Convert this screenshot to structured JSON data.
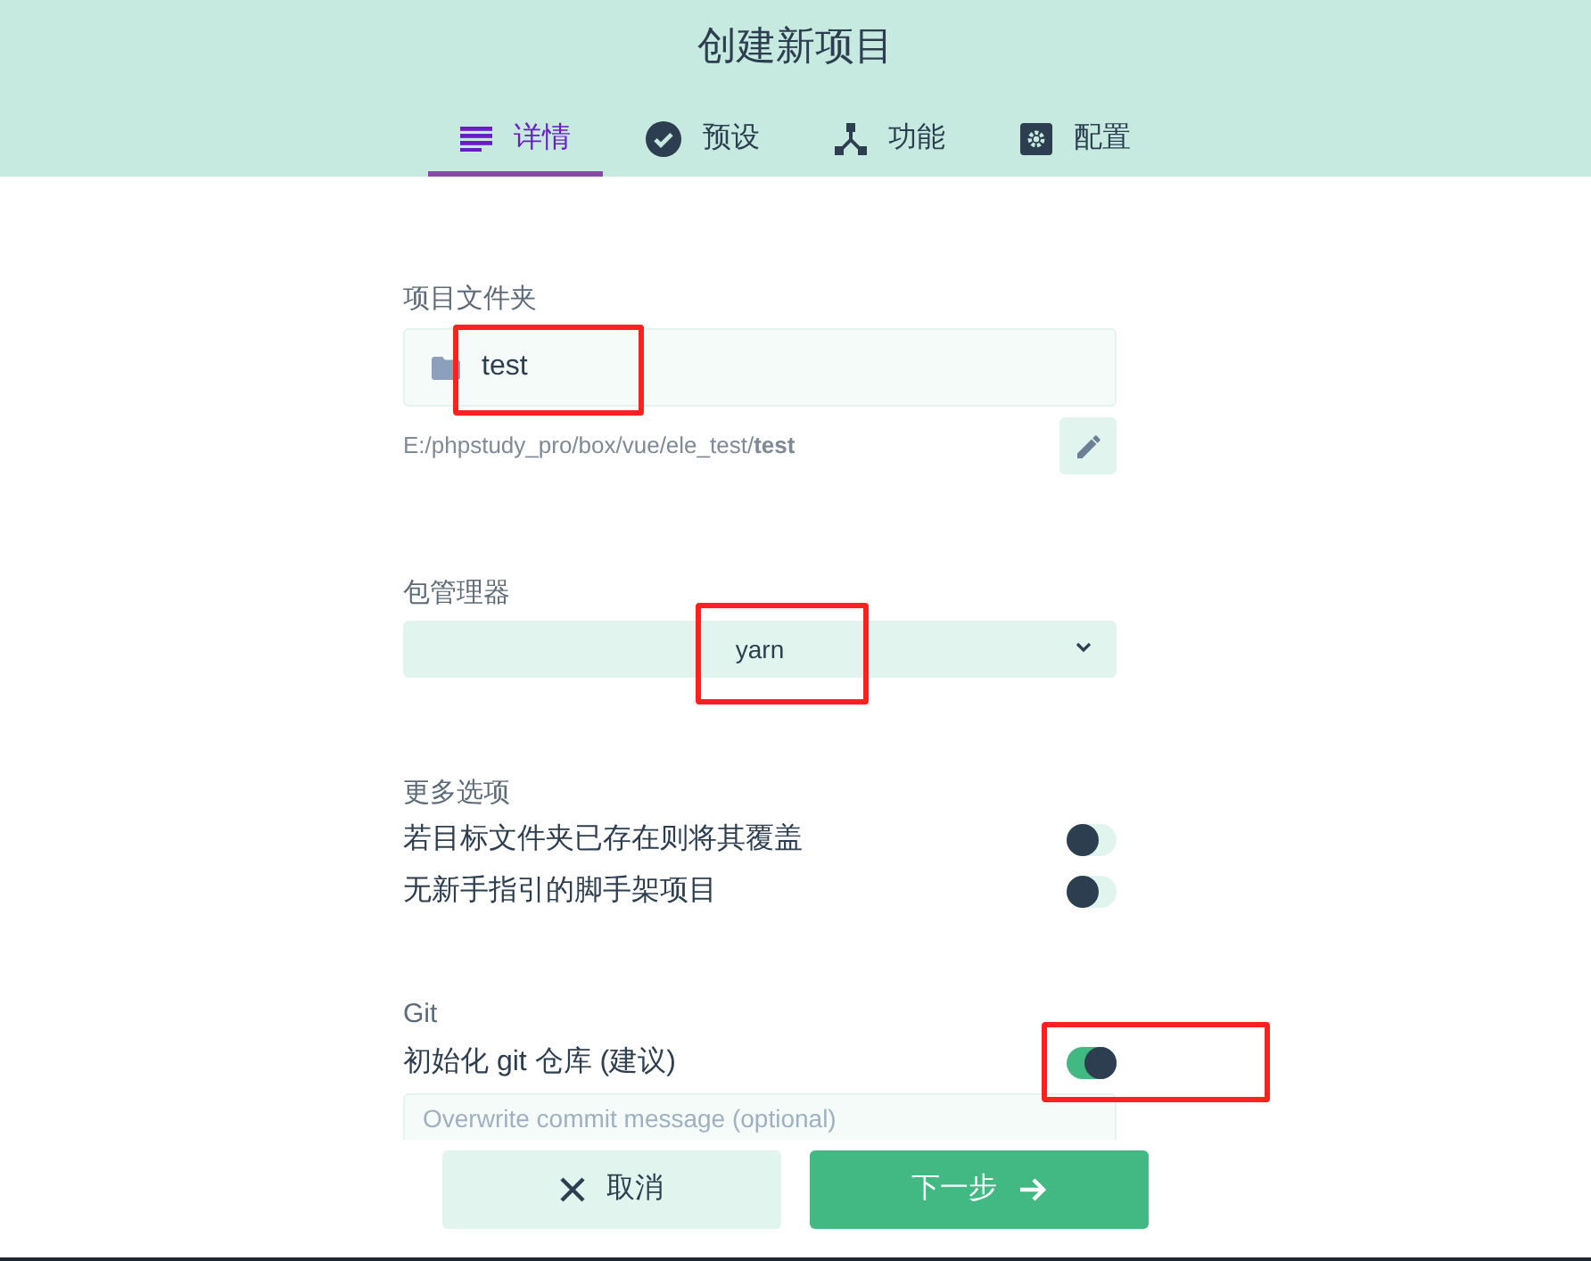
{
  "title": "创建新项目",
  "tabs": [
    {
      "label": "详情",
      "kind": "list",
      "selected": true
    },
    {
      "label": "预设",
      "kind": "check",
      "selected": false
    },
    {
      "label": "功能",
      "kind": "fork",
      "selected": false
    },
    {
      "label": "配置",
      "kind": "gear",
      "selected": false
    }
  ],
  "folder": {
    "label": "项目文件夹",
    "value": "test",
    "path": "E:/phpstudy_pro/box/vue/ele_test/**test**",
    "highlighted": true
  },
  "package_manager": {
    "label": "包管理器",
    "value": "yarn",
    "highlighted": true
  },
  "more_options": {
    "label": "更多选项",
    "options": [
      {
        "label": "若目标文件夹已存在则将其覆盖",
        "on": false
      },
      {
        "label": "无新手指引的脚手架项目",
        "on": false
      }
    ]
  },
  "git": {
    "label": "Git",
    "option": {
      "label": "初始化 git 仓库 (建议)",
      "on": true,
      "highlighted": true
    },
    "commit": {
      "placeholder": "Overwrite commit message (optional)"
    }
  },
  "buttons": [
    {
      "kind": "cancel",
      "label": "取消"
    },
    {
      "kind": "next",
      "label": "下一步"
    }
  ]
}
